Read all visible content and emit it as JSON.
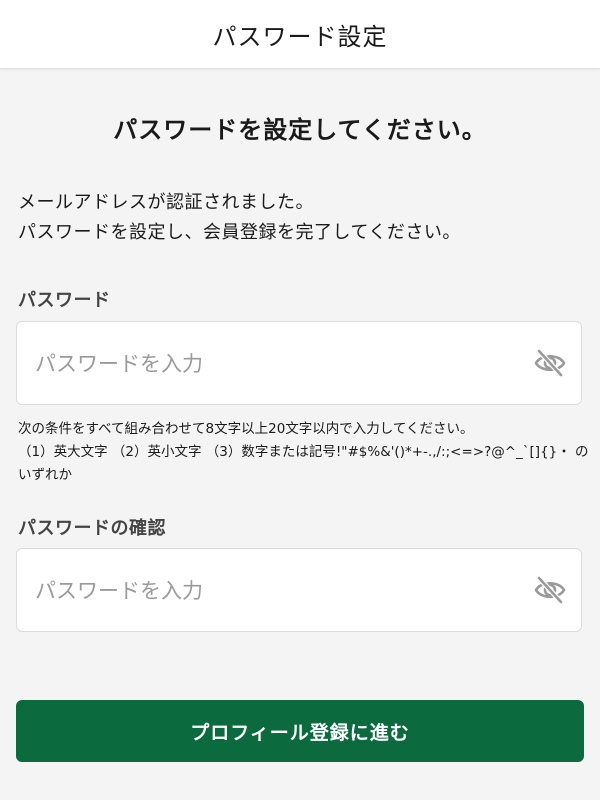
{
  "header": {
    "title": "パスワード設定"
  },
  "main": {
    "heading": "パスワードを設定してください。",
    "intro_line1": "メールアドレスが認証されました。",
    "intro_line2": "パスワードを設定し、会員登録を完了してください。",
    "password_field": {
      "label": "パスワード",
      "placeholder": "パスワードを入力",
      "value": ""
    },
    "hint": {
      "line1": "次の条件をすべて組み合わせて8文字以上20文字以内で入力してください。",
      "line2": "（1）英大文字 （2）英小文字 （3）数字または記号!\"#$%&'()*+-.,/:;<=>?@^_`[]{}・ の",
      "line3": "いずれか"
    },
    "confirm_field": {
      "label": "パスワードの確認",
      "placeholder": "パスワードを入力",
      "value": ""
    },
    "submit_label": "プロフィール登録に進む"
  },
  "colors": {
    "accent": "#0b6b3e",
    "background": "#f4f4f4",
    "icon": "#9a9a9a"
  },
  "icons": {
    "password_toggle": "eye-off-icon",
    "confirm_toggle": "eye-off-icon"
  }
}
